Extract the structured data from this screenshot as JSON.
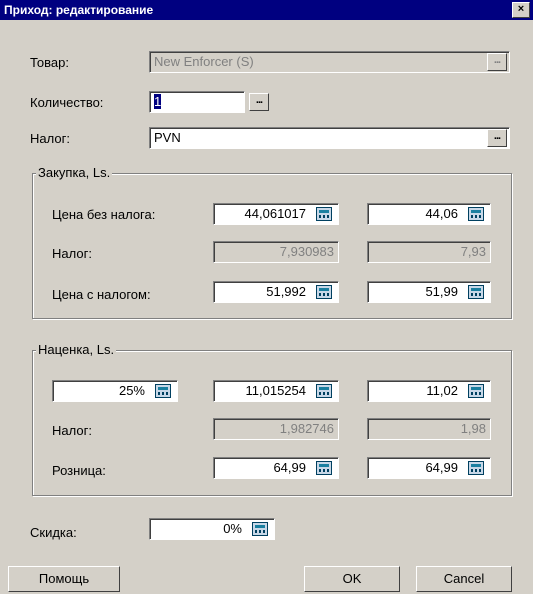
{
  "window": {
    "title": "Приход: редактирование",
    "close": "×"
  },
  "form": {
    "product_label": "Товар:",
    "product_value": "New Enforcer (S)",
    "quantity_label": "Количество:",
    "quantity_value": "1",
    "tax_label": "Налог:",
    "tax_value": "PVN",
    "ellipsis": "..."
  },
  "purchase": {
    "title": "Закупка, Ls.",
    "price_no_tax_label": "Цена без налога:",
    "price_no_tax_1": "44,061017",
    "price_no_tax_2": "44,06",
    "tax_label": "Налог:",
    "tax_1": "7,930983",
    "tax_2": "7,93",
    "price_with_tax_label": "Цена с налогом:",
    "price_with_tax_1": "51,992",
    "price_with_tax_2": "51,99"
  },
  "markup": {
    "title": "Наценка, Ls.",
    "percent": "25%",
    "markup_1": "11,015254",
    "markup_2": "11,02",
    "tax_label": "Налог:",
    "tax_1": "1,982746",
    "tax_2": "1,98",
    "retail_label": "Розница:",
    "retail_1": "64,99",
    "retail_2": "64,99"
  },
  "discount": {
    "label": "Скидка:",
    "value": "0%"
  },
  "buttons": {
    "help": "Помощь",
    "ok": "OK",
    "cancel": "Cancel"
  }
}
